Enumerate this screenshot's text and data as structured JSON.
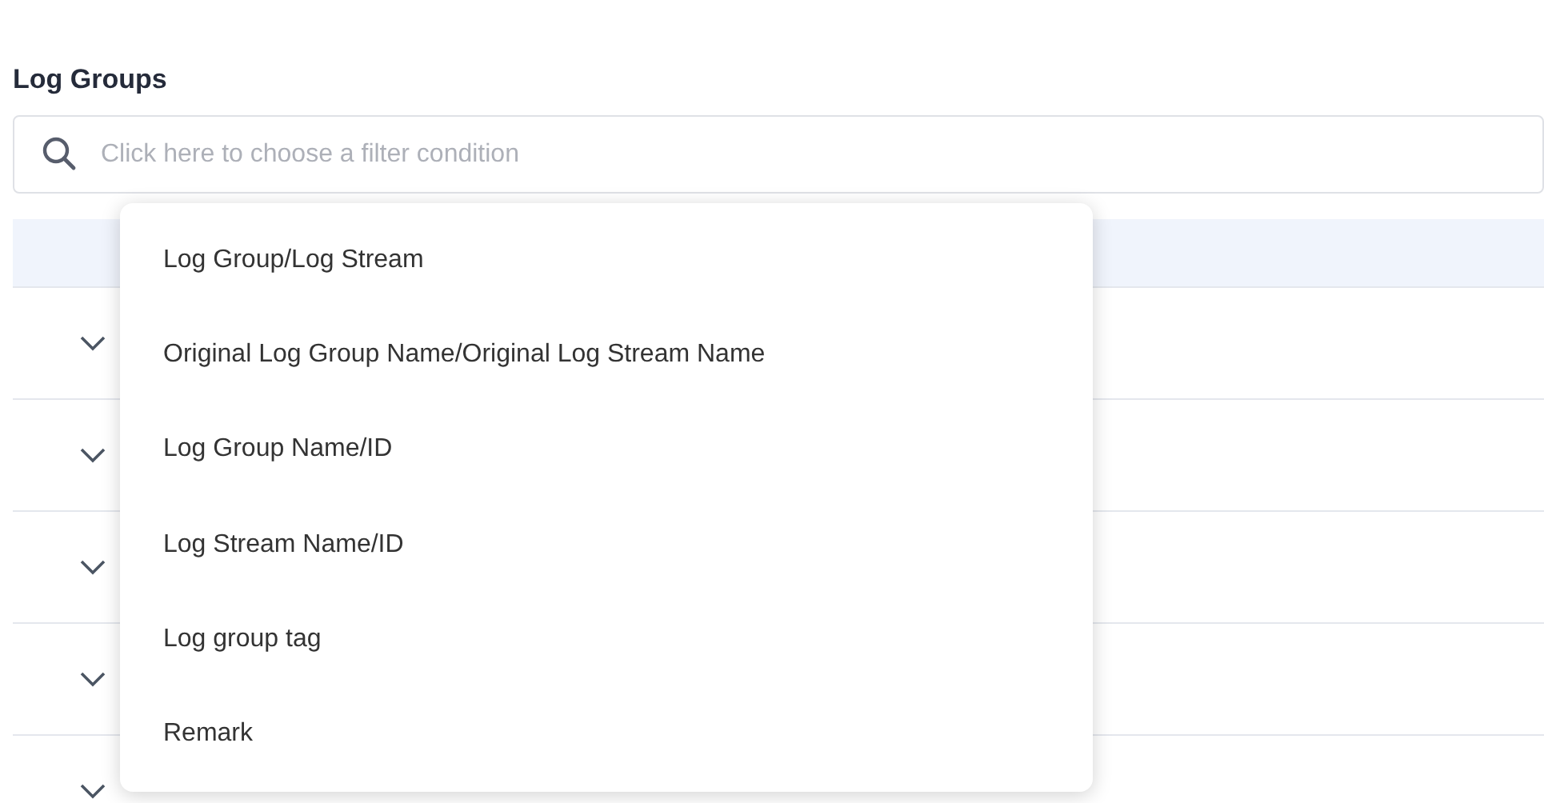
{
  "title": "Log Groups",
  "search": {
    "placeholder": "Click here to choose a filter condition"
  },
  "filter_menu": {
    "options": [
      {
        "label": "Log Group/Log Stream",
        "selected": false
      },
      {
        "label": "Original Log Group Name/Original Log Stream Name",
        "selected": false
      },
      {
        "label": "Log Group Name/ID",
        "selected": false
      },
      {
        "label": "Log Stream Name/ID",
        "selected": false
      },
      {
        "label": "Log group tag",
        "selected": false
      },
      {
        "label": "Remark",
        "selected": false
      }
    ]
  },
  "table": {
    "rows": [
      {
        "expanded": false
      },
      {
        "expanded": false
      },
      {
        "expanded": false
      },
      {
        "expanded": false
      },
      {
        "expanded": false
      }
    ]
  }
}
